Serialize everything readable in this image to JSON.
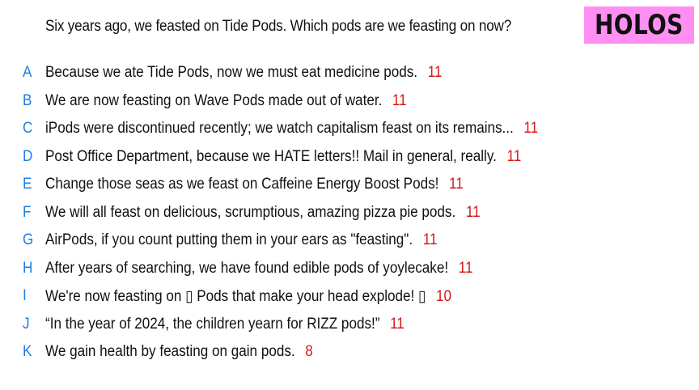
{
  "question": "Six years ago, we feasted on Tide Pods. Which pods are we feasting on now?",
  "brand": "HOLOS",
  "colors": {
    "badge_bg": "#ff8ff2",
    "letter": "#1f7fe0",
    "count": "#d81818",
    "text": "#111111"
  },
  "answers": [
    {
      "letter": "A",
      "text": "Because we ate Tide Pods, now we must eat medicine pods.",
      "count": "11"
    },
    {
      "letter": "B",
      "text": "We are now feasting on Wave Pods made out of water.",
      "count": "11"
    },
    {
      "letter": "C",
      "text": "iPods were discontinued recently; we watch capitalism feast on its remains...",
      "count": "11"
    },
    {
      "letter": "D",
      "text": "Post Office Department, because we HATE letters!! Mail in general, really.",
      "count": "11"
    },
    {
      "letter": "E",
      "text": "Change those seas as we feast on Caffeine Energy Boost Pods!",
      "count": "11"
    },
    {
      "letter": "F",
      "text": "We will all feast on delicious, scrumptious, amazing pizza pie pods.",
      "count": "11"
    },
    {
      "letter": "G",
      "text": "AirPods, if you count putting them in your ears as \"feasting\".",
      "count": "11"
    },
    {
      "letter": "H",
      "text": "After years of searching, we have found edible pods of yoylecake!",
      "count": "11"
    },
    {
      "letter": "I",
      "text": "We're now feasting on ▯ Pods that make your head explode! ▯",
      "count": "10"
    },
    {
      "letter": "J",
      "text": "“In the year of 2024, the children yearn for RIZZ pods!”",
      "count": "11"
    },
    {
      "letter": "K",
      "text": "We gain health by feasting on gain pods.",
      "count": "8"
    }
  ]
}
